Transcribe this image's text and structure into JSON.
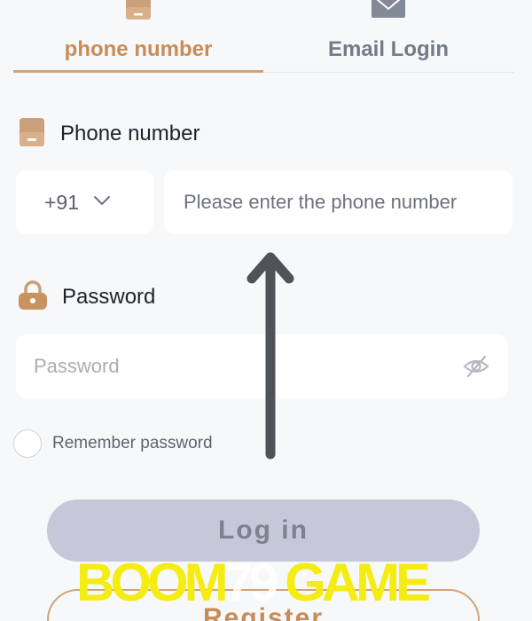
{
  "tabs": {
    "phone_label": "phone number",
    "email_label": "Email Login"
  },
  "phone_section": {
    "label": "Phone number",
    "country_code": "+91",
    "placeholder": "Please enter the phone number"
  },
  "password_section": {
    "label": "Password",
    "placeholder": "Password"
  },
  "remember": {
    "label": "Remember password"
  },
  "buttons": {
    "login": "Log in",
    "register": "Register"
  },
  "watermark": {
    "part1": "BOOM",
    "part2": "79",
    "part3": "GAME"
  },
  "colors": {
    "accent": "#c78c58",
    "inactive_tab": "#747a87",
    "login_bg": "#c5c8d8",
    "watermark": "#f5ec13"
  },
  "icons": {
    "phone_tab": "phone-icon",
    "email_tab": "envelope-icon",
    "phone_field": "phone-icon",
    "password_field": "lock-icon",
    "toggle_visibility": "eye-off-icon",
    "country_dropdown": "chevron-down-icon"
  }
}
